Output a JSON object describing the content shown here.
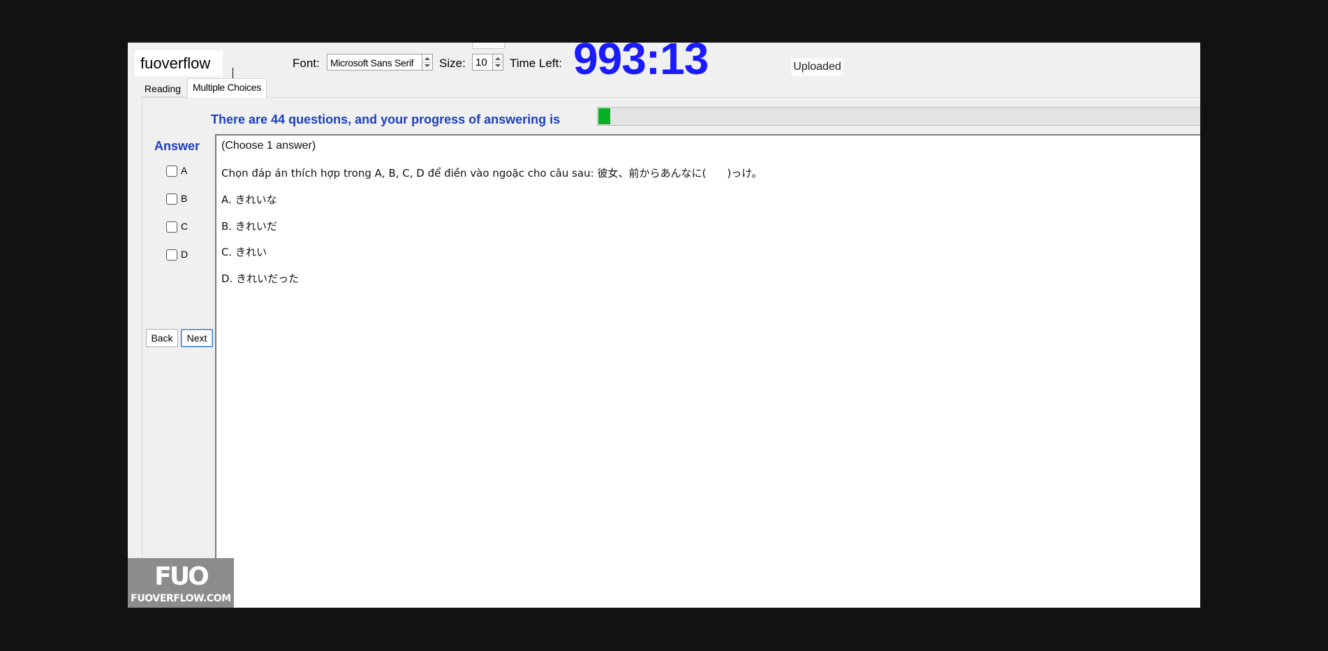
{
  "toolbar": {
    "username": "fuoverflow",
    "font_label": "Font:",
    "font_value": "Microsoft Sans Serif",
    "size_label": "Size:",
    "size_value": "10",
    "time_left_label": "Time Left:",
    "timer": "993:13",
    "upload_status": "Uploaded"
  },
  "tabs": [
    {
      "label": "Reading",
      "active": false
    },
    {
      "label": "Multiple Choices",
      "active": true
    }
  ],
  "progress": {
    "text": "There are 44 questions, and your progress of answering is",
    "value_fraction": 0.02,
    "fill_color": "#06b025"
  },
  "answer": {
    "title": "Answer",
    "options": [
      {
        "label": "A",
        "checked": false
      },
      {
        "label": "B",
        "checked": false
      },
      {
        "label": "C",
        "checked": false
      },
      {
        "label": "D",
        "checked": false
      }
    ]
  },
  "nav": {
    "back_label": "Back",
    "next_label": "Next"
  },
  "question": {
    "instruction": "(Choose 1 answer)",
    "prompt": "Chọn đáp án thích hợp trong A, B, C, D để điền vào ngoặc cho câu sau:   彼女、前からあんなに(　　)っけ。",
    "choices": [
      "A. きれいな",
      "B. きれいだ",
      "C. きれい",
      "D. きれいだった"
    ]
  },
  "watermark": {
    "logo": "FUO",
    "url": "FUOVERFLOW.COM"
  },
  "colors": {
    "timer": "#1a1aff",
    "heading_blue": "#1a3fc0",
    "progress_green": "#06b025"
  }
}
